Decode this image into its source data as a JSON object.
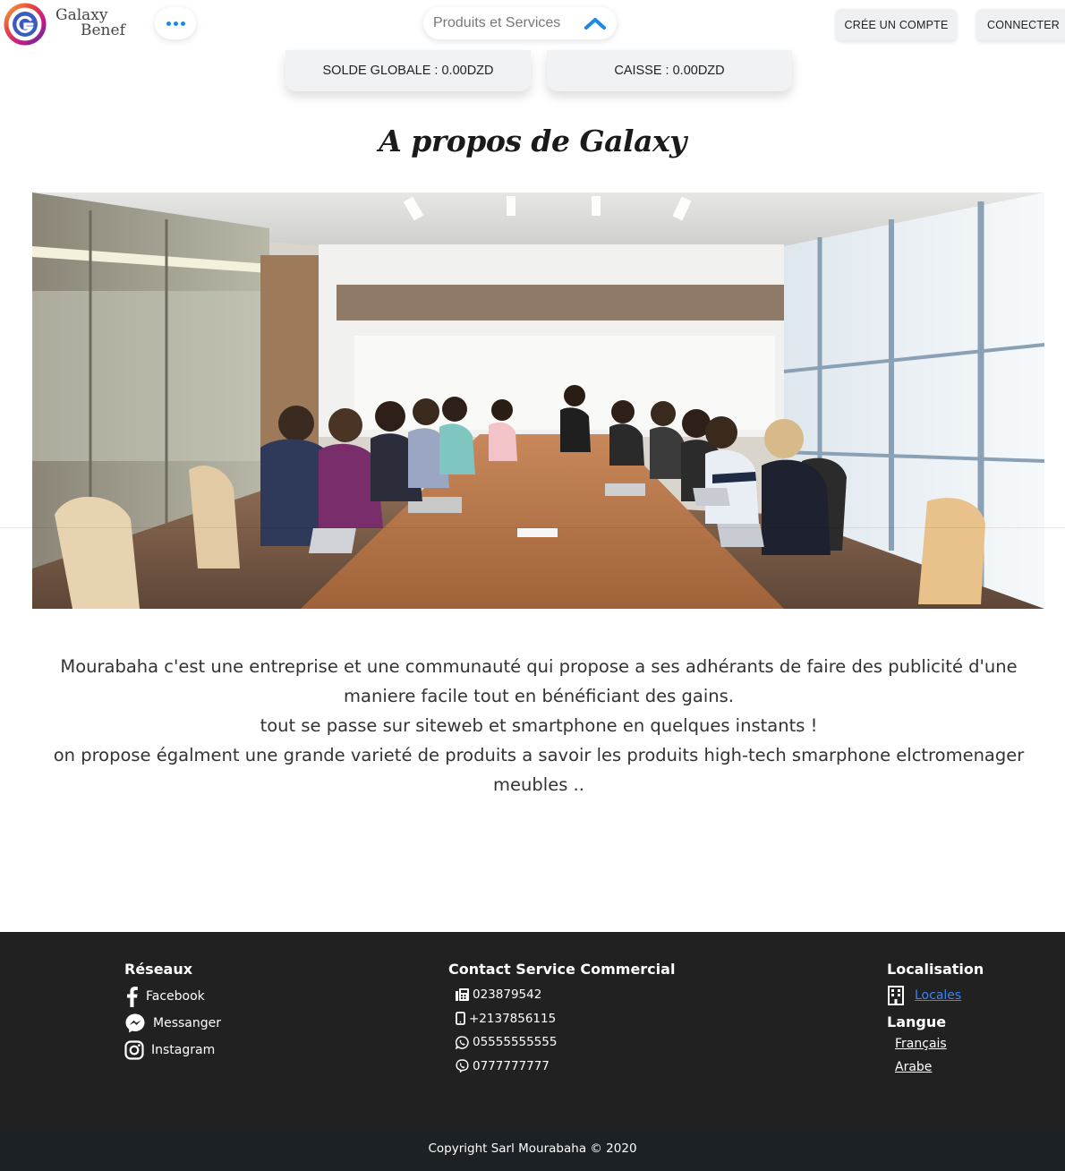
{
  "brand": {
    "line1": "Galaxy",
    "line2": "Benef",
    "logo_icon": "galaxy-g-logo"
  },
  "header": {
    "menu_icon": "dots-horizontal",
    "products_label": "Produits et Services",
    "products_icon": "chevron-up",
    "create_account_label": "CRÉE UN COMPTE",
    "connect_label": "CONNECTER",
    "balance_global": "SOLDE GLOBALE : 0.00DZD",
    "balance_caisse": "CAISSE : 0.00DZD"
  },
  "main": {
    "title": "A propos de Galaxy",
    "paragraphs": [
      "Mourabaha c'est une entreprise et une communauté qui propose a ses adhérants de faire des publicité d'une maniere facile tout en bénéficiant des gains.",
      "tout se passe sur siteweb et smartphone en quelques instants !",
      "on propose égalment une grande varieté de produits a savoir les produits high-tech smarphone elctromenager meubles .."
    ]
  },
  "footer": {
    "social": {
      "title": "Réseaux",
      "items": [
        {
          "label": "Facebook",
          "icon": "facebook-icon"
        },
        {
          "label": "Messanger",
          "icon": "messenger-icon"
        },
        {
          "label": "Instagram",
          "icon": "instagram-icon"
        }
      ]
    },
    "contact": {
      "title": "Contact Service Commercial",
      "items": [
        {
          "label": "023879542",
          "icon": "fax-icon"
        },
        {
          "label": "+2137856115",
          "icon": "mobile-icon"
        },
        {
          "label": "05555555555",
          "icon": "whatsapp-icon"
        },
        {
          "label": "0777777777",
          "icon": "viber-icon"
        }
      ]
    },
    "location": {
      "title": "Localisation",
      "link_label": "Locales",
      "icon": "building-icon"
    },
    "language": {
      "title": "Langue",
      "options": [
        "Français",
        "Arabe"
      ]
    },
    "copyright": "Copyright Sarl Mourabaha © 2020"
  },
  "colors": {
    "accent": "#1e88e5",
    "footer_bg": "#212121",
    "copyright_bg": "#1b2125",
    "link": "#3b82f6"
  }
}
